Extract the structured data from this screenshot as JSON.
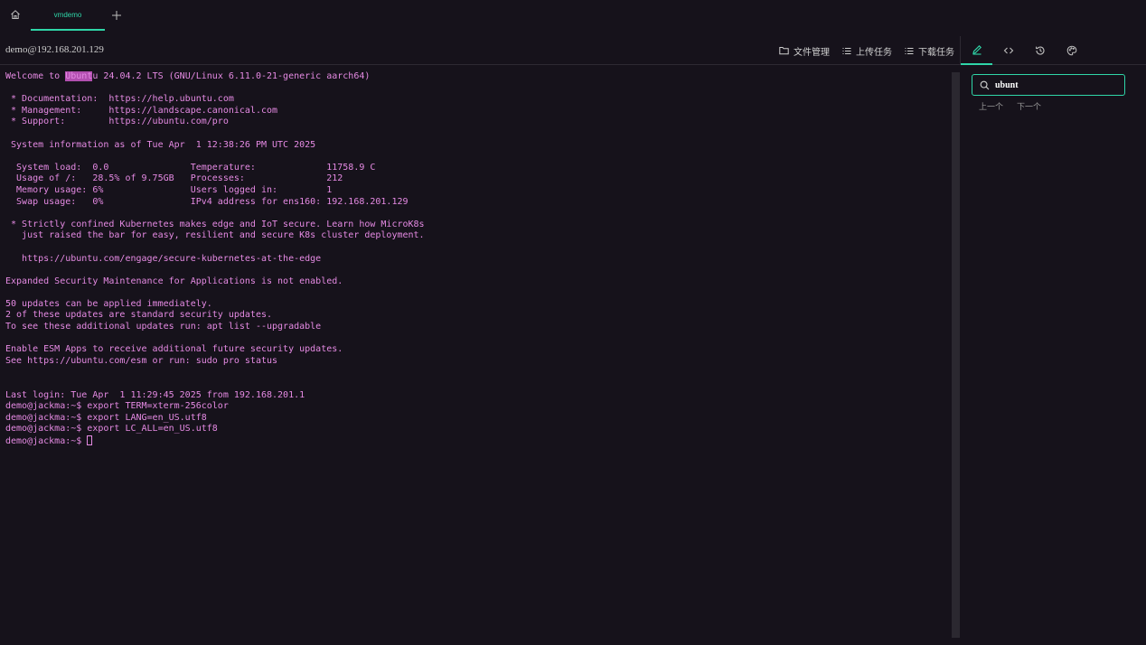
{
  "tabbar": {
    "home_icon": "home-icon",
    "tabs": [
      {
        "label": "vmdemo",
        "active": true
      }
    ],
    "add_icon": "plus-icon"
  },
  "header": {
    "host": "demo@192.168.201.129",
    "toolbar": [
      {
        "label": "文件管理",
        "icon": "folder-icon"
      },
      {
        "label": "上传任务",
        "icon": "list-icon"
      },
      {
        "label": "下载任务",
        "icon": "list-icon"
      }
    ],
    "side_tabs": [
      {
        "icon": "pencil-icon",
        "active": true
      },
      {
        "icon": "code-icon",
        "active": false
      },
      {
        "icon": "history-icon",
        "active": false
      },
      {
        "icon": "palette-icon",
        "active": false
      }
    ]
  },
  "terminal": {
    "lines": [
      "Welcome to |Ubunt|u 24.04.2 LTS (GNU/Linux 6.11.0-21-generic aarch64)",
      "",
      " * Documentation:  https://help.ubuntu.com",
      " * Management:     https://landscape.canonical.com",
      " * Support:        https://ubuntu.com/pro",
      "",
      " System information as of Tue Apr  1 12:38:26 PM UTC 2025",
      "",
      "  System load:  0.0               Temperature:             11758.9 C",
      "  Usage of /:   28.5% of 9.75GB   Processes:               212",
      "  Memory usage: 6%                Users logged in:         1",
      "  Swap usage:   0%                IPv4 address for ens160: 192.168.201.129",
      "",
      " * Strictly confined Kubernetes makes edge and IoT secure. Learn how MicroK8s",
      "   just raised the bar for easy, resilient and secure K8s cluster deployment.",
      "",
      "   https://ubuntu.com/engage/secure-kubernetes-at-the-edge",
      "",
      "Expanded Security Maintenance for Applications is not enabled.",
      "",
      "50 updates can be applied immediately.",
      "2 of these updates are standard security updates.",
      "To see these additional updates run: apt list --upgradable",
      "",
      "Enable ESM Apps to receive additional future security updates.",
      "See https://ubuntu.com/esm or run: sudo pro status",
      "",
      "",
      "Last login: Tue Apr  1 11:29:45 2025 from 192.168.201.1",
      "demo@jackma:~$ export TERM=xterm-256color",
      "demo@jackma:~$ export LANG=en_US.utf8",
      "demo@jackma:~$ export LC_ALL=en_US.utf8",
      "demo@jackma:~$ "
    ],
    "highlight": "Ubunt"
  },
  "search": {
    "value": "ubunt",
    "prev_label": "上一个",
    "next_label": "下一个"
  },
  "colors": {
    "accent": "#2fd6a8",
    "terminal_text": "#e58ae3",
    "background": "#16121b",
    "match_highlight": "#b24fb0"
  }
}
